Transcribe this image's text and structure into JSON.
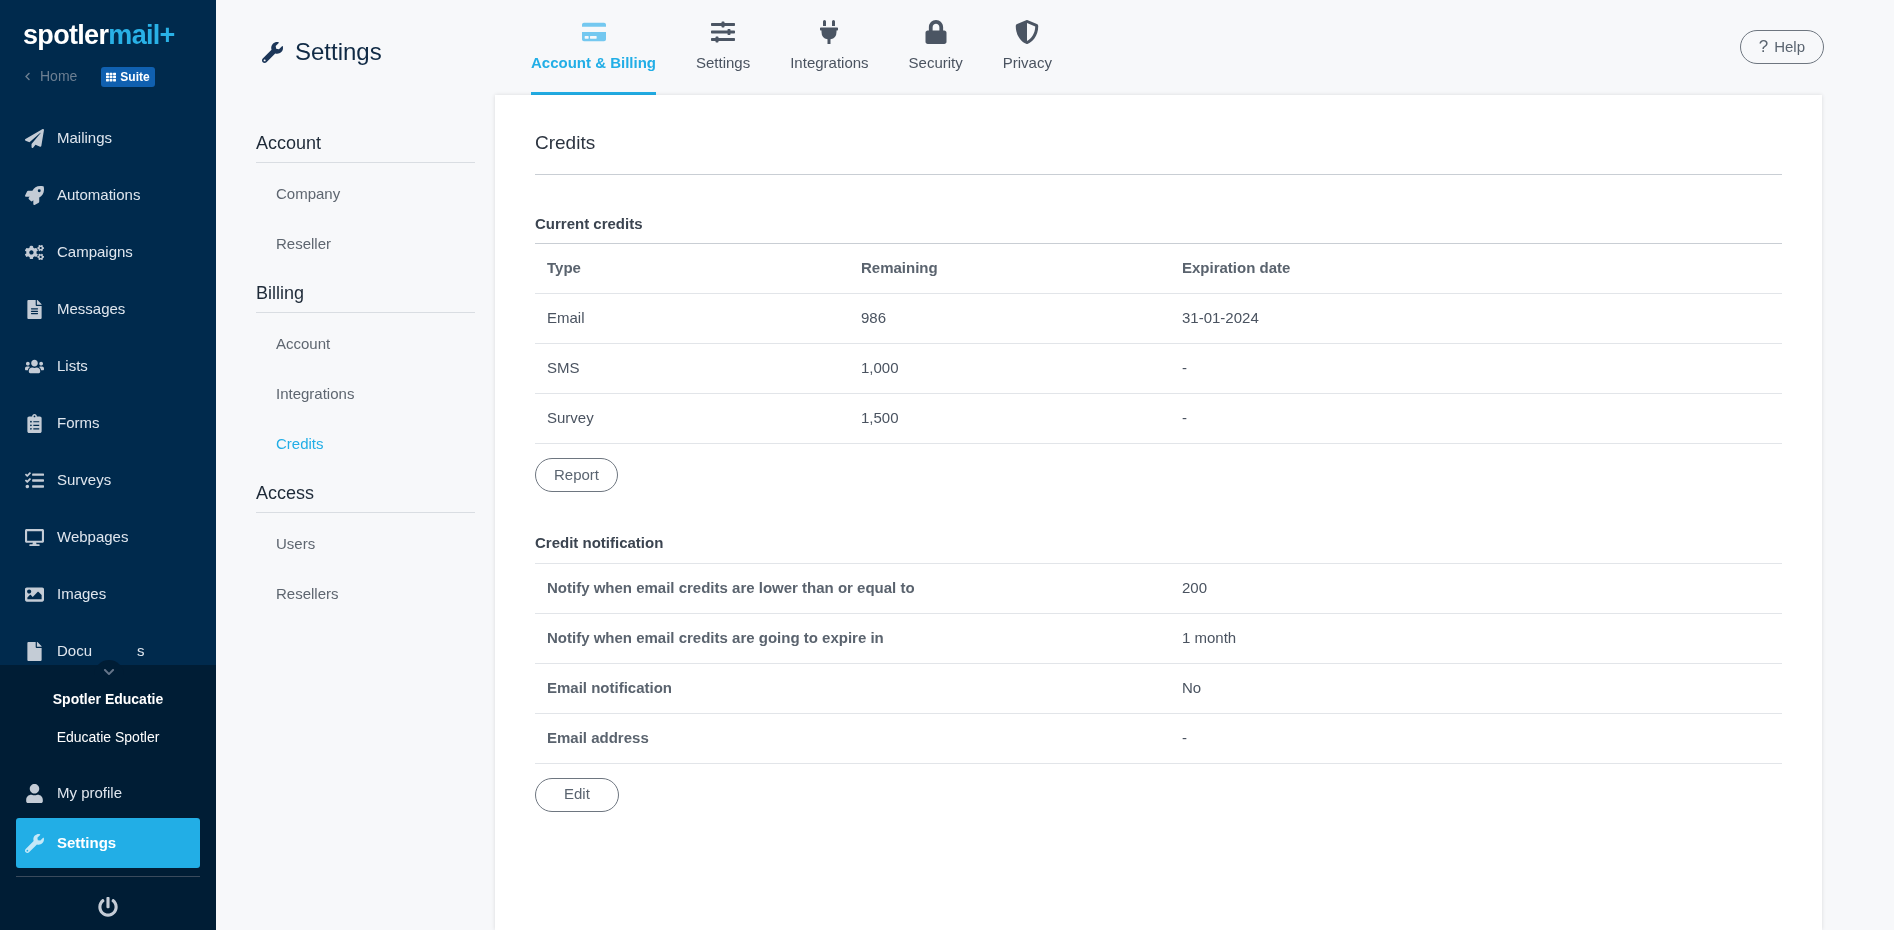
{
  "sidebar": {
    "logo": {
      "part1": "spotler",
      "part2": "mail+"
    },
    "home_link": "Home",
    "suite_badge": "Suite",
    "items": [
      {
        "label": "Mailings",
        "selected": false
      },
      {
        "label": "Automations",
        "selected": false
      },
      {
        "label": "Campaigns",
        "selected": false
      },
      {
        "label": "Messages",
        "selected": false
      },
      {
        "label": "Lists",
        "selected": false
      },
      {
        "label": "Forms",
        "selected": false
      },
      {
        "label": "Surveys",
        "selected": false
      },
      {
        "label": "Webpages",
        "selected": false
      },
      {
        "label": "Images",
        "selected": false
      },
      {
        "label": "Docu",
        "label_end": "s",
        "selected": false
      }
    ],
    "account": {
      "name": "Spotler Educatie",
      "subname": "Educatie Spotler"
    },
    "bottom_items": [
      {
        "label": "My profile",
        "selected": false
      },
      {
        "label": "Settings",
        "selected": true
      }
    ]
  },
  "header": {
    "title": "Settings",
    "tabs": [
      {
        "label": "Account & Billing",
        "selected": true
      },
      {
        "label": "Settings",
        "selected": false
      },
      {
        "label": "Integrations",
        "selected": false
      },
      {
        "label": "Security",
        "selected": false
      },
      {
        "label": "Privacy",
        "selected": false
      }
    ],
    "help_icon": "?",
    "help_button": "Help"
  },
  "subnav": [
    {
      "title": "Account",
      "items": [
        {
          "label": "Company",
          "selected": false
        },
        {
          "label": "Reseller",
          "selected": false
        }
      ]
    },
    {
      "title": "Billing",
      "items": [
        {
          "label": "Account",
          "selected": false
        },
        {
          "label": "Integrations",
          "selected": false
        },
        {
          "label": "Credits",
          "selected": true
        }
      ]
    },
    {
      "title": "Access",
      "items": [
        {
          "label": "Users",
          "selected": false
        },
        {
          "label": "Resellers",
          "selected": false
        }
      ]
    }
  ],
  "content": {
    "title": "Credits",
    "current_credits": {
      "heading": "Current credits",
      "columns": [
        "Type",
        "Remaining",
        "Expiration date"
      ],
      "rows": [
        [
          "Email",
          "986",
          "31-01-2024"
        ],
        [
          "SMS",
          "1,000",
          "-"
        ],
        [
          "Survey",
          "1,500",
          "-"
        ]
      ],
      "button": "Report"
    },
    "credit_notification": {
      "heading": "Credit notification",
      "rows": [
        {
          "label": "Notify when email credits are lower than or equal to",
          "value": "200"
        },
        {
          "label": "Notify when email credits are going to expire in",
          "value": "1 month"
        },
        {
          "label": "Email notification",
          "value": "No"
        },
        {
          "label": "Email address",
          "value": "-"
        }
      ],
      "button": "Edit"
    }
  }
}
